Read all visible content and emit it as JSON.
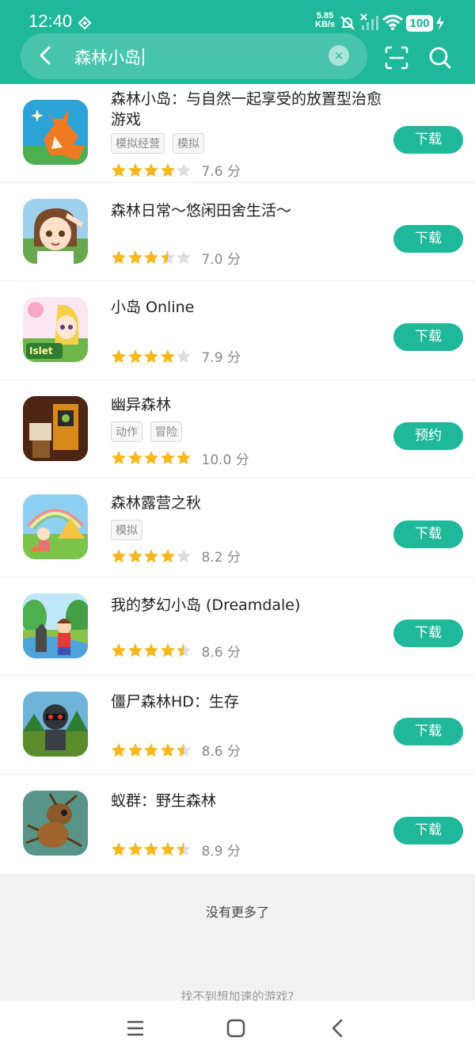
{
  "status": {
    "time": "12:40",
    "net_speed_value": "5.85",
    "net_speed_unit": "KB/s",
    "battery": "100"
  },
  "search": {
    "query": "森林小岛",
    "clear_symbol": "×"
  },
  "colors": {
    "accent": "#20b89a",
    "star": "#f8b71c",
    "star_empty": "#dddddd"
  },
  "icons": {
    "back": "back-arrow-icon",
    "scan": "scan-icon",
    "search": "search-icon",
    "menu": "menu-icon",
    "home": "home-square-icon",
    "nav_back": "back-chevron-icon"
  },
  "results": [
    {
      "title": "森林小岛：与自然一起享受的放置型治愈游戏",
      "tags": [
        "模拟经营",
        "模拟"
      ],
      "rating": 4,
      "score": "7.6 分",
      "action": "下载"
    },
    {
      "title": "森林日常～悠闲田舍生活～",
      "tags": [],
      "rating": 3.5,
      "score": "7.0 分",
      "action": "下载"
    },
    {
      "title": "小岛 Online",
      "tags": [],
      "rating": 4,
      "score": "7.9 分",
      "action": "下载"
    },
    {
      "title": "幽异森林",
      "tags": [
        "动作",
        "冒险"
      ],
      "rating": 5,
      "score": "10.0 分",
      "action": "预约"
    },
    {
      "title": "森林露营之秋",
      "tags": [
        "模拟"
      ],
      "rating": 4,
      "score": "8.2 分",
      "action": "下载"
    },
    {
      "title": "我的梦幻小岛 (Dreamdale)",
      "tags": [],
      "rating": 4.5,
      "score": "8.6 分",
      "action": "下载"
    },
    {
      "title": "僵尸森林HD：生存",
      "tags": [],
      "rating": 4.5,
      "score": "8.6 分",
      "action": "下载"
    },
    {
      "title": "蚁群：野生森林",
      "tags": [],
      "rating": 4.5,
      "score": "8.9 分",
      "action": "下载"
    }
  ],
  "no_more": "没有更多了",
  "footer_hint": "找不到想加速的游戏?"
}
